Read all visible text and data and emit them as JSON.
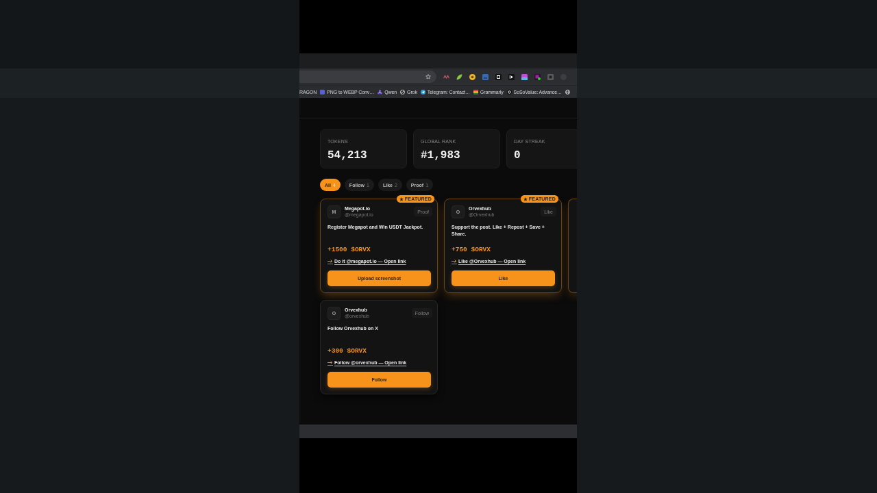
{
  "browser": {
    "bookmarks": [
      {
        "kind": "plain",
        "label": "RAGON"
      },
      {
        "kind": "square",
        "label": "PNG to WEBP Conv…"
      },
      {
        "kind": "flower",
        "label": "Qwen"
      },
      {
        "kind": "ring",
        "label": "Grok"
      },
      {
        "kind": "plane",
        "label": "Telegram: Contact…"
      },
      {
        "kind": "stripes",
        "label": "Grammarly"
      },
      {
        "kind": "disc",
        "label": "SoSoValue: Advance…"
      },
      {
        "kind": "globe"
      }
    ]
  },
  "stats": [
    {
      "label": "TOKENS",
      "value": "54,213"
    },
    {
      "label": "GLOBAL RANK",
      "value": "#1,983"
    },
    {
      "label": "DAY STREAK",
      "value": "0"
    }
  ],
  "filters": [
    {
      "label": "All",
      "count": "4",
      "selected": true
    },
    {
      "label": "Follow",
      "count": "1",
      "selected": false
    },
    {
      "label": "Like",
      "count": "2",
      "selected": false
    },
    {
      "label": "Proof",
      "count": "1",
      "selected": false
    }
  ],
  "tasks": [
    {
      "featured": true,
      "badge": "FEATURED",
      "avatar": "M",
      "name": "Megapot.io",
      "handle": "@megapot.io",
      "type": "Proof",
      "description": "Register Megapot and Win USDT Jackpot.",
      "reward": "+1500 $ORVX",
      "link": "Do it @megapot.io — Open link",
      "button": "Upload screenshot"
    },
    {
      "featured": true,
      "badge": "FEATURED",
      "avatar": "O",
      "name": "Orvexhub",
      "handle": "@Orvexhub",
      "type": "Like",
      "description": "Support the post. Like + Repost + Save + Share.",
      "reward": "+750 $ORVX",
      "link": "Like @Orvexhub — Open link",
      "button": "Like"
    },
    {
      "featured": true
    },
    {
      "featured": false,
      "avatar": "O",
      "name": "Orvexhub",
      "handle": "@orvexhub",
      "type": "Follow",
      "description": "Follow Orvexhub on X",
      "reward": "+300 $ORVX",
      "link": "Follow @orvexhub — Open link",
      "button": "Follow"
    }
  ]
}
